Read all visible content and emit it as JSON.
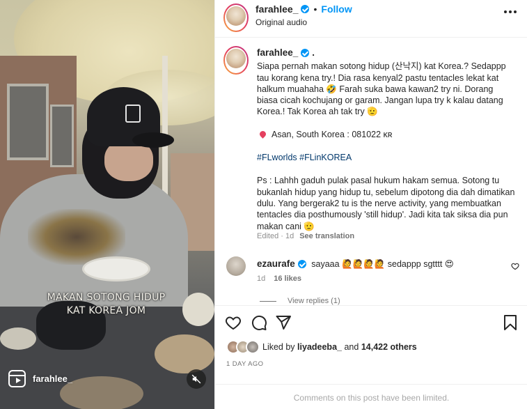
{
  "media": {
    "overlay_line1": "MAKAN SOTONG HIDUP",
    "overlay_line2": "KAT KOREA JOM",
    "reel_username": "farahlee_",
    "reel_icon": "reels-icon",
    "mute_icon": "muted-speaker-icon"
  },
  "header": {
    "username": "farahlee_",
    "dot": "•",
    "follow_label": "Follow",
    "audio": "Original audio",
    "more_icon": "more-options-icon"
  },
  "caption": {
    "username": "farahlee_",
    "username_suffix": ".",
    "para1": "Siapa pernah makan sotong hidup (산낙지) kat Korea.? Sedappp tau korang kena try.! Dia rasa kenyal2 pastu tentacles lekat kat halkum muahaha 🤣 Farah suka bawa kawan2 try ni. Dorang biasa cicah kochujang or garam. Jangan lupa try k kalau datang Korea.! Tak Korea ah tak try 🫡",
    "location": "Asan, South Korea : 081022 ᴋʀ",
    "hashtags": "#FLworlds #FLinKOREA",
    "para2": "Ps : Lahhh gaduh pulak pasal hukum hakam semua. Sotong tu bukanlah hidup yang hidup tu, sebelum dipotong dia dah dimatikan dulu. Yang bergerak2 tu is the nerve activity, yang membuatkan tentacles dia posthumously 'still hidup'. Jadi kita tak siksa dia pun makan cani 🫡",
    "edited": "Edited · 1d",
    "see_translation": "See translation"
  },
  "comment": {
    "username": "ezaurafe",
    "text": "sayaaa 🙋🙋🙋🙋 sedappp sgtttt 😍",
    "time": "1d",
    "likes": "16 likes",
    "view_replies": "View replies (1)"
  },
  "likes": {
    "prefix": "Liked by",
    "user": "liyadeeba_",
    "middle": "and",
    "count": "14,422 others"
  },
  "date": "1 DAY AGO",
  "limited": "Comments on this post have been limited.",
  "colors": {
    "accent": "#0095f6",
    "text": "#262626",
    "muted": "#737373",
    "hashtag": "#00376b"
  }
}
